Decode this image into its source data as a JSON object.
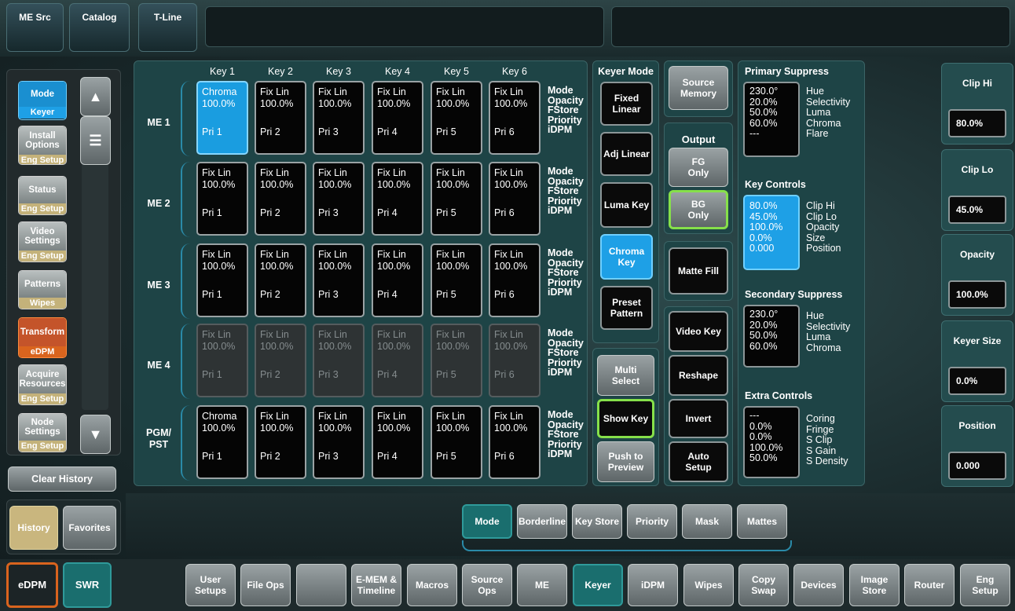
{
  "top_tabs": [
    "ME Src",
    "Catalog",
    "T-Line"
  ],
  "side_scroll_menu": "☰",
  "side_items": [
    {
      "top": "Mode",
      "bottom": "Keyer"
    },
    {
      "top": "Install Options",
      "bottom": "Eng Setup"
    },
    {
      "top": "Status",
      "bottom": "Eng Setup"
    },
    {
      "top": "Video Settings",
      "bottom": "Eng Setup"
    },
    {
      "top": "Patterns",
      "bottom": "Wipes"
    },
    {
      "top": "Transform",
      "bottom": "eDPM"
    },
    {
      "top": "Acquire Resources",
      "bottom": "Eng Setup"
    },
    {
      "top": "Node Settings",
      "bottom": "Eng Setup"
    }
  ],
  "clear_history": "Clear History",
  "history": "History",
  "favorites": "Favorites",
  "edpm": "eDPM",
  "swr": "SWR",
  "key_headers": [
    "Key 1",
    "Key 2",
    "Key 3",
    "Key 4",
    "Key 5",
    "Key 6"
  ],
  "mode_labels": [
    "Mode",
    "Opacity",
    "FStore",
    "Priority",
    "iDPM"
  ],
  "rows": [
    {
      "label": "ME 1",
      "keys": [
        [
          "Chroma",
          "100.0%",
          "Pri 1"
        ],
        [
          "Fix Lin",
          "100.0%",
          "Pri 2"
        ],
        [
          "Fix Lin",
          "100.0%",
          "Pri 3"
        ],
        [
          "Fix Lin",
          "100.0%",
          "Pri 4"
        ],
        [
          "Fix Lin",
          "100.0%",
          "Pri 5"
        ],
        [
          "Fix Lin",
          "100.0%",
          "Pri 6"
        ]
      ]
    },
    {
      "label": "ME 2",
      "keys": [
        [
          "Fix Lin",
          "100.0%",
          "Pri 1"
        ],
        [
          "Fix Lin",
          "100.0%",
          "Pri 2"
        ],
        [
          "Fix Lin",
          "100.0%",
          "Pri 3"
        ],
        [
          "Fix Lin",
          "100.0%",
          "Pri 4"
        ],
        [
          "Fix Lin",
          "100.0%",
          "Pri 5"
        ],
        [
          "Fix Lin",
          "100.0%",
          "Pri 6"
        ]
      ]
    },
    {
      "label": "ME 3",
      "keys": [
        [
          "Fix Lin",
          "100.0%",
          "Pri 1"
        ],
        [
          "Fix Lin",
          "100.0%",
          "Pri 2"
        ],
        [
          "Fix Lin",
          "100.0%",
          "Pri 3"
        ],
        [
          "Fix Lin",
          "100.0%",
          "Pri 4"
        ],
        [
          "Fix Lin",
          "100.0%",
          "Pri 5"
        ],
        [
          "Fix Lin",
          "100.0%",
          "Pri 6"
        ]
      ]
    },
    {
      "label": "ME 4",
      "keys": [
        [
          "Fix Lin",
          "100.0%",
          "Pri 1"
        ],
        [
          "Fix Lin",
          "100.0%",
          "Pri 2"
        ],
        [
          "Fix Lin",
          "100.0%",
          "Pri 3"
        ],
        [
          "Fix Lin",
          "100.0%",
          "Pri 4"
        ],
        [
          "Fix Lin",
          "100.0%",
          "Pri 5"
        ],
        [
          "Fix Lin",
          "100.0%",
          "Pri 6"
        ]
      ]
    },
    {
      "label": "PGM/ PST",
      "keys": [
        [
          "Chroma",
          "100.0%",
          "Pri 1"
        ],
        [
          "Fix Lin",
          "100.0%",
          "Pri 2"
        ],
        [
          "Fix Lin",
          "100.0%",
          "Pri 3"
        ],
        [
          "Fix Lin",
          "100.0%",
          "Pri 4"
        ],
        [
          "Fix Lin",
          "100.0%",
          "Pri 5"
        ],
        [
          "Fix Lin",
          "100.0%",
          "Pri 6"
        ]
      ]
    }
  ],
  "keyer_mode": {
    "title": "Keyer Mode",
    "buttons": [
      "Fixed Linear",
      "Adj Linear",
      "Luma Key",
      "Chroma Key",
      "Preset Pattern"
    ]
  },
  "multi_select": "Multi Select",
  "show_key": "Show Key",
  "push_to_preview": "Push to Preview",
  "source_memory": "Source Memory",
  "output": {
    "title": "Output",
    "fg": "FG Only",
    "bg": "BG Only"
  },
  "matte_fill": "Matte Fill",
  "video_key": "Video Key",
  "reshape": "Reshape",
  "invert": "Invert",
  "auto_setup": "Auto Setup",
  "primary_suppress": {
    "title": "Primary Suppress",
    "values": [
      "230.0°",
      "20.0%",
      "50.0%",
      "60.0%",
      "---"
    ],
    "labels": [
      "Hue",
      "Selectivity",
      "Luma",
      "Chroma",
      "Flare"
    ]
  },
  "key_controls": {
    "title": "Key Controls",
    "values": [
      "80.0%",
      "45.0%",
      "100.0%",
      "0.0%",
      "0.000"
    ],
    "labels": [
      "Clip Hi",
      "Clip Lo",
      "Opacity",
      "Size",
      "Position"
    ]
  },
  "secondary_suppress": {
    "title": "Secondary Suppress",
    "values": [
      "230.0°",
      "20.0%",
      "50.0%",
      "60.0%"
    ],
    "labels": [
      "Hue",
      "Selectivity",
      "Luma",
      "Chroma"
    ]
  },
  "extra_controls": {
    "title": "Extra Controls",
    "values": [
      "---",
      "0.0%",
      "0.0%",
      "100.0%",
      "50.0%"
    ],
    "labels": [
      "Coring",
      "Fringe",
      "S Clip",
      "S Gain",
      "S Density"
    ]
  },
  "right_params": [
    {
      "label": "Clip Hi",
      "value": "80.0%"
    },
    {
      "label": "Clip Lo",
      "value": "45.0%"
    },
    {
      "label": "Opacity",
      "value": "100.0%"
    },
    {
      "label": "Keyer Size",
      "value": "0.0%"
    },
    {
      "label": "Position",
      "value": "0.000"
    }
  ],
  "sub_tabs": [
    "Mode",
    "Borderline",
    "Key Store",
    "Priority",
    "Mask",
    "Mattes"
  ],
  "bottom_tabs": [
    "User Setups",
    "File Ops",
    "",
    "E-MEM & Timeline",
    "Macros",
    "Source Ops",
    "ME",
    "Keyer",
    "iDPM",
    "Wipes",
    "Copy Swap",
    "Devices",
    "Image Store",
    "Router",
    "Eng Setup"
  ]
}
